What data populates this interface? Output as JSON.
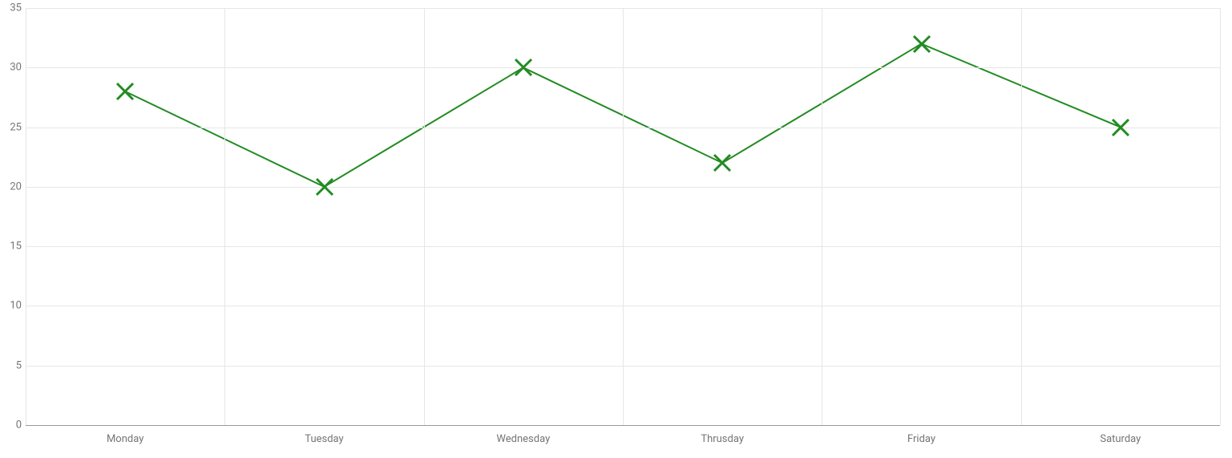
{
  "chart_data": {
    "type": "line",
    "categories": [
      "Monday",
      "Tuesday",
      "Wednesday",
      "Thrusday",
      "Friday",
      "Saturday"
    ],
    "values": [
      28,
      20,
      30,
      22,
      32,
      25
    ],
    "title": "",
    "xlabel": "",
    "ylabel": "",
    "ylim": [
      0,
      35
    ],
    "y_ticks": [
      0,
      5,
      10,
      15,
      20,
      25,
      30,
      35
    ],
    "series_color": "#228B22",
    "marker": "x"
  }
}
